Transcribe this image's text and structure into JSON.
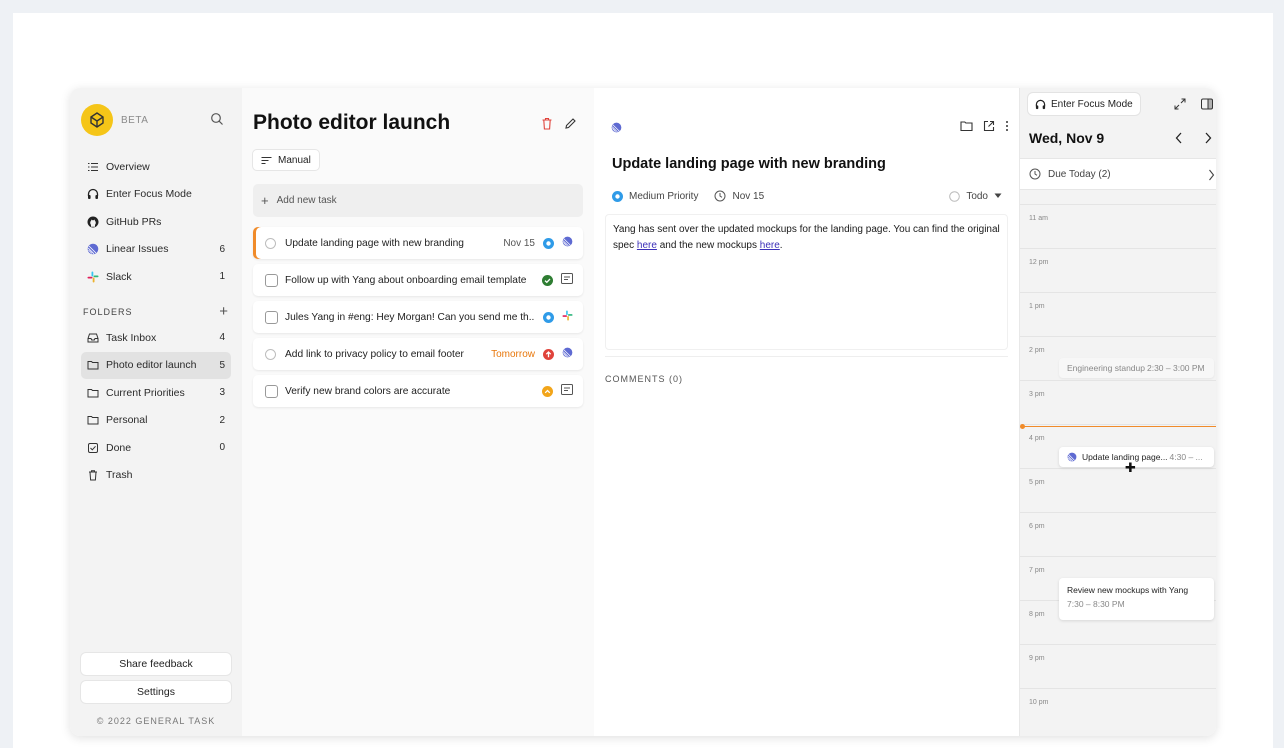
{
  "sidebar": {
    "beta_label": "BETA",
    "nav": [
      {
        "label": "Overview",
        "count": "",
        "icon": "list-icon"
      },
      {
        "label": "Enter Focus Mode",
        "count": "",
        "icon": "headphones-icon"
      },
      {
        "label": "GitHub PRs",
        "count": "",
        "icon": "github-icon"
      },
      {
        "label": "Linear Issues",
        "count": "6",
        "icon": "linear-icon"
      },
      {
        "label": "Slack",
        "count": "1",
        "icon": "slack-icon"
      }
    ],
    "folders_label": "FOLDERS",
    "folders": [
      {
        "label": "Task Inbox",
        "count": "4",
        "icon": "inbox-icon"
      },
      {
        "label": "Photo editor launch",
        "count": "5",
        "icon": "folder-icon"
      },
      {
        "label": "Current Priorities",
        "count": "3",
        "icon": "folder-icon"
      },
      {
        "label": "Personal",
        "count": "2",
        "icon": "folder-icon"
      },
      {
        "label": "Done",
        "count": "0",
        "icon": "checkbox-icon"
      },
      {
        "label": "Trash",
        "count": "",
        "icon": "trash-icon"
      }
    ],
    "share_feedback": "Share feedback",
    "settings": "Settings",
    "copyright": "© 2022 GENERAL TASK"
  },
  "task_list": {
    "title": "Photo editor launch",
    "sort_label": "Manual",
    "add_placeholder": "Add new task",
    "tasks": [
      {
        "title": "Update landing page with new branding",
        "due": "Nov 15",
        "check": "circle",
        "priority": "medium",
        "source": "linear"
      },
      {
        "title": "Follow up with Yang about onboarding email template",
        "due": "",
        "check": "square",
        "priority": "done",
        "source": "gmail"
      },
      {
        "title": "Jules Yang in #eng: Hey Morgan! Can you send me th...",
        "due": "",
        "check": "square",
        "priority": "medium",
        "source": "slack"
      },
      {
        "title": "Add link to privacy policy to email footer",
        "due": "Tomorrow",
        "check": "circle",
        "priority": "urgent",
        "source": "linear"
      },
      {
        "title": "Verify new brand colors are accurate",
        "due": "",
        "check": "square",
        "priority": "high",
        "source": "gmail"
      }
    ]
  },
  "detail": {
    "title": "Update landing page with new branding",
    "priority": "Medium Priority",
    "due": "Nov 15",
    "status": "Todo",
    "desc_part1": "Yang has sent over the updated mockups for the landing page. You can find the original spec ",
    "link1": "here",
    "desc_part2": " and the new mockups ",
    "link2": "here",
    "desc_part3": ".",
    "comments_label": "COMMENTS (0)"
  },
  "calendar": {
    "focus_label": "Enter Focus Mode",
    "date": "Wed, Nov 9",
    "due_today": "Due Today (2)",
    "hours": [
      "11 am",
      "12 pm",
      "1 pm",
      "2 pm",
      "3 pm",
      "4 pm",
      "5 pm",
      "6 pm",
      "7 pm",
      "8 pm",
      "9 pm",
      "10 pm"
    ],
    "events": {
      "standup_title": "Engineering standup",
      "standup_time": "2:30 – 3:00 PM",
      "landing_title": "Update landing page...",
      "landing_time": "4:30 – ...",
      "review_title": "Review new mockups with Yang",
      "review_time": "7:30 – 8:30 PM"
    }
  },
  "colors": {
    "accent_orange": "#f08b2a",
    "linear_purple": "#5e6ad2",
    "priority_blue": "#2f9be8",
    "priority_red": "#e0433b",
    "priority_yellow": "#f2a51a",
    "done_green": "#2e7d32"
  }
}
